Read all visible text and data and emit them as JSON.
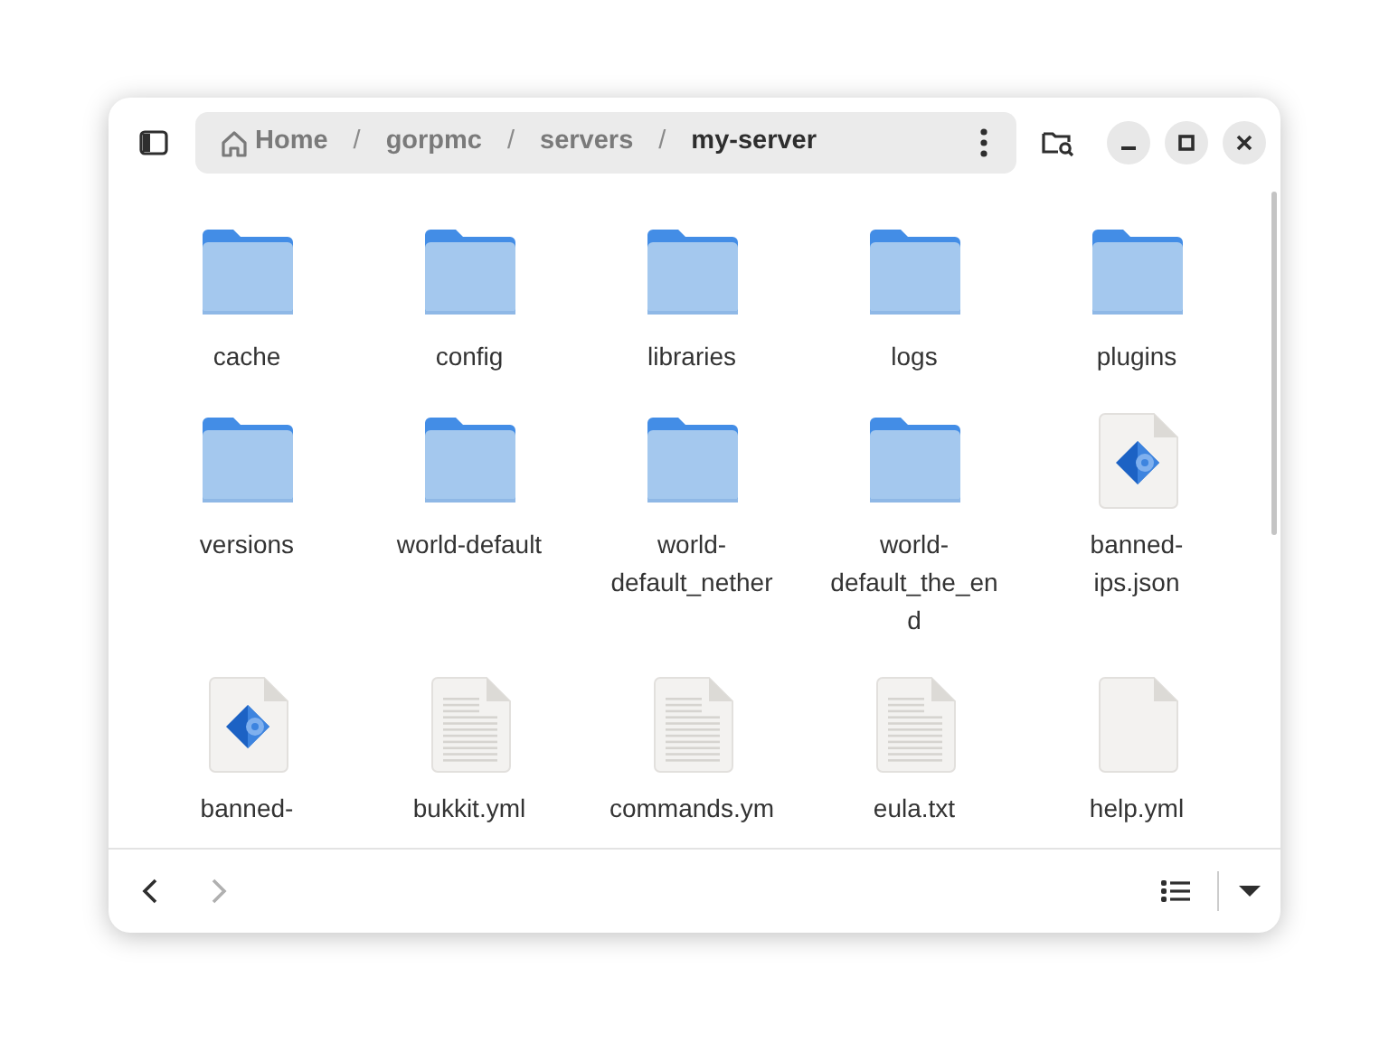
{
  "breadcrumbs": [
    {
      "label": "Home",
      "kind": "home",
      "selected": false
    },
    {
      "label": "gorpmc",
      "kind": "folder",
      "selected": false
    },
    {
      "label": "servers",
      "kind": "folder",
      "selected": false
    },
    {
      "label": "my-server",
      "kind": "folder",
      "selected": true
    }
  ],
  "separator": "/",
  "files": [
    {
      "name": "cache",
      "kind": "folder"
    },
    {
      "name": "config",
      "kind": "folder"
    },
    {
      "name": "libraries",
      "kind": "folder"
    },
    {
      "name": "logs",
      "kind": "folder"
    },
    {
      "name": "plugins",
      "kind": "folder"
    },
    {
      "name": "versions",
      "kind": "folder"
    },
    {
      "name": "world-default",
      "kind": "folder"
    },
    {
      "name": "world-default_nether",
      "kind": "folder"
    },
    {
      "name": "world-default_the_end",
      "kind": "folder"
    },
    {
      "name": "banned-ips.json",
      "kind": "json"
    },
    {
      "name": "banned-",
      "kind": "json"
    },
    {
      "name": "bukkit.yml",
      "kind": "text"
    },
    {
      "name": "commands.ym",
      "kind": "text"
    },
    {
      "name": "eula.txt",
      "kind": "text"
    },
    {
      "name": "help.yml",
      "kind": "blank"
    }
  ],
  "navigation": {
    "back_disabled": false,
    "forward_disabled": true
  }
}
